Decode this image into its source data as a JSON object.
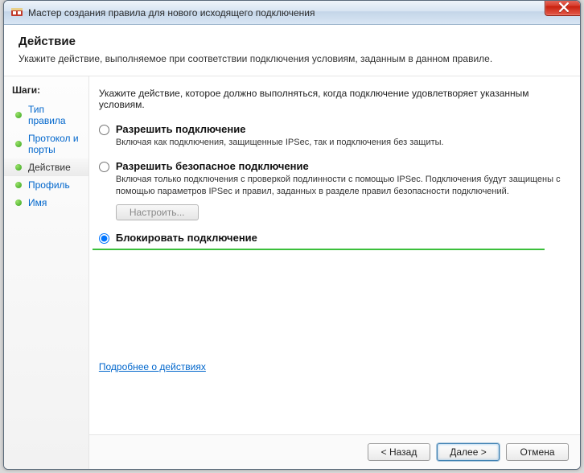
{
  "window": {
    "title": "Мастер создания правила для нового исходящего подключения"
  },
  "header": {
    "title": "Действие",
    "subtitle": "Укажите действие, выполняемое при соответствии подключения условиям, заданным в данном правиле."
  },
  "sidebar": {
    "steps_label": "Шаги:",
    "items": [
      {
        "label": "Тип правила",
        "current": false
      },
      {
        "label": "Протокол и порты",
        "current": false
      },
      {
        "label": "Действие",
        "current": true
      },
      {
        "label": "Профиль",
        "current": false
      },
      {
        "label": "Имя",
        "current": false
      }
    ]
  },
  "content": {
    "intro": "Укажите действие, которое должно выполняться, когда подключение удовлетворяет указанным условиям.",
    "options": [
      {
        "id": "allow",
        "title": "Разрешить подключение",
        "desc": "Включая как подключения, защищенные IPSec, так и подключения без защиты.",
        "selected": false,
        "has_config": false
      },
      {
        "id": "allow-secure",
        "title": "Разрешить безопасное подключение",
        "desc": "Включая только подключения с проверкой подлинности с помощью IPSec. Подключения будут защищены с помощью параметров IPSec и правил, заданных в разделе правил безопасности подключений.",
        "selected": false,
        "has_config": true,
        "config_label": "Настроить..."
      },
      {
        "id": "block",
        "title": "Блокировать подключение",
        "desc": "",
        "selected": true,
        "has_config": false
      }
    ],
    "learn_more": "Подробнее о действиях"
  },
  "footer": {
    "back": "< Назад",
    "next": "Далее >",
    "cancel": "Отмена"
  }
}
